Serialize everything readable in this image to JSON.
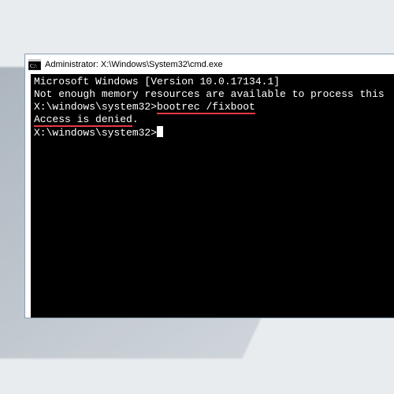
{
  "window": {
    "title": "Administrator: X:\\Windows\\System32\\cmd.exe"
  },
  "console": {
    "line1": "Microsoft Windows [Version 10.0.17134.1]",
    "line2": "Not enough memory resources are available to process this ",
    "blank1": "",
    "prompt1_prefix": "X:\\windows\\system32>",
    "command1": "bootrec /fixboot",
    "response1": "Access is denied",
    "response1_period": ".",
    "blank2": "",
    "prompt2": "X:\\windows\\system32>"
  }
}
